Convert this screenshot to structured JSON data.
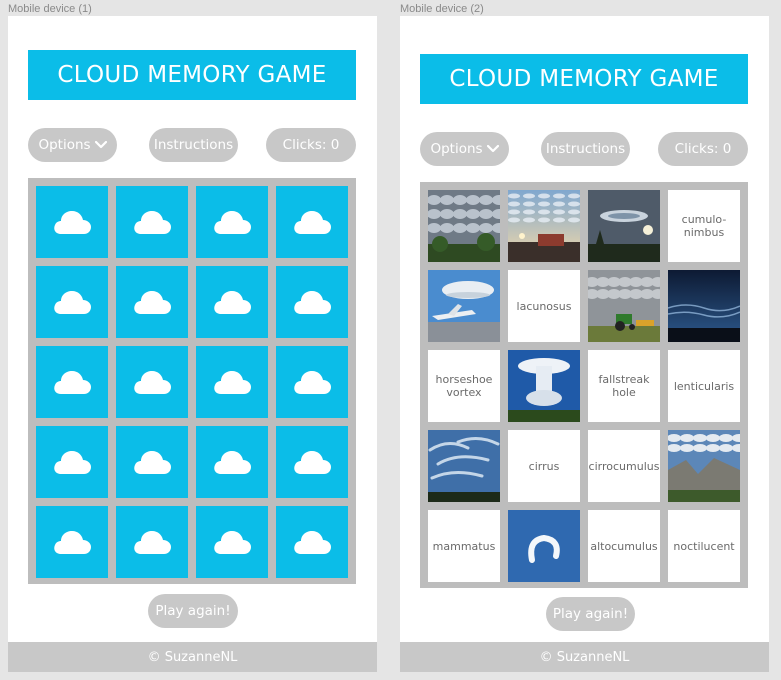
{
  "frames": {
    "device1_label": "Mobile device (1)",
    "device2_label": "Mobile device (2)"
  },
  "app": {
    "title": "CLOUD MEMORY GAME",
    "options_label": "Options",
    "instructions_label": "Instructions",
    "clicks_label": "Clicks: 0",
    "play_again_label": "Play again!",
    "footer": "© SuzanneNL"
  },
  "colors": {
    "accent": "#0bbde8",
    "button": "#c8c8c8",
    "board": "#bdbdbd"
  },
  "device2_cards": [
    {
      "type": "photo",
      "icon": "altocumulus-photo"
    },
    {
      "type": "photo",
      "icon": "cirrocumulus-sunset-photo"
    },
    {
      "type": "photo",
      "icon": "fallstreak-hole-photo"
    },
    {
      "type": "word",
      "label": "cumulo-\nnimbus"
    },
    {
      "type": "photo",
      "icon": "lenticularis-plane-photo"
    },
    {
      "type": "word",
      "label": "lacunosus"
    },
    {
      "type": "photo",
      "icon": "tractor-clouds-photo"
    },
    {
      "type": "photo",
      "icon": "noctilucent-photo"
    },
    {
      "type": "word",
      "label": "horseshoe\nvortex"
    },
    {
      "type": "photo",
      "icon": "cumulonimbus-photo"
    },
    {
      "type": "word",
      "label": "fallstreak\nhole"
    },
    {
      "type": "word",
      "label": "lenticularis"
    },
    {
      "type": "photo",
      "icon": "cirrus-photo"
    },
    {
      "type": "word",
      "label": "cirrus"
    },
    {
      "type": "word",
      "label": "cirrocumulus"
    },
    {
      "type": "photo",
      "icon": "mountain-clouds-photo"
    },
    {
      "type": "word",
      "label": "mammatus"
    },
    {
      "type": "photo",
      "icon": "horseshoe-vortex-photo"
    },
    {
      "type": "word",
      "label": "altocumulus"
    },
    {
      "type": "word",
      "label": "noctilucent"
    }
  ]
}
